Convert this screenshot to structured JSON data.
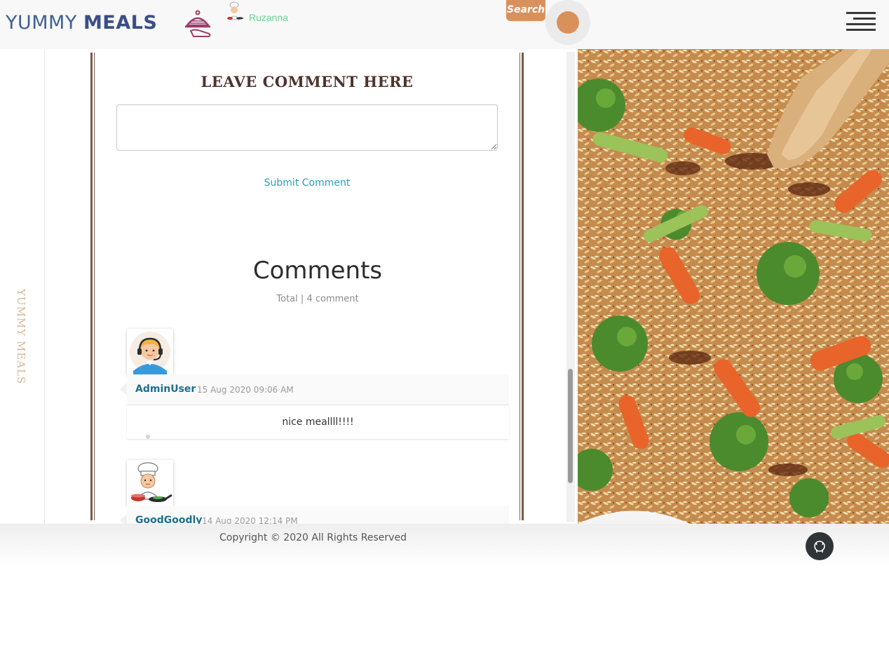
{
  "header": {
    "brand_part1": "YUMMY",
    "brand_part2": "MEALS",
    "user_name": "Ruzanna",
    "search_label": "Search"
  },
  "rail": {
    "text": "YUMMY MEALS"
  },
  "comment_form": {
    "title": "LEAVE COMMENT HERE",
    "textarea_value": "",
    "submit_label": "Submit Comment"
  },
  "comments": {
    "title": "Comments",
    "total_label": "Total",
    "separator": "|",
    "count_text": "4 comment",
    "items": [
      {
        "author": "AdminUser",
        "date": "15 Aug 2020 09:06 AM",
        "text": "nice meallll!!!!",
        "avatar": "support-agent-avatar-icon"
      },
      {
        "author": "GoodGoodly",
        "date": "14 Aug 2020 12:14 PM",
        "text": "",
        "avatar": "chef-cooking-avatar-icon"
      }
    ]
  },
  "footer": {
    "copyright": "Copyright © 2020 All Rights Reserved",
    "github_icon": "github-icon"
  },
  "colors": {
    "accent_orange": "#d9915c",
    "brand_blue": "#3b5a8c",
    "frame_brown": "#7a5a48",
    "link_teal": "#2aa0b8",
    "user_green": "#6dcf8e"
  },
  "hero_image": "fried-rice-vegetables-photo"
}
